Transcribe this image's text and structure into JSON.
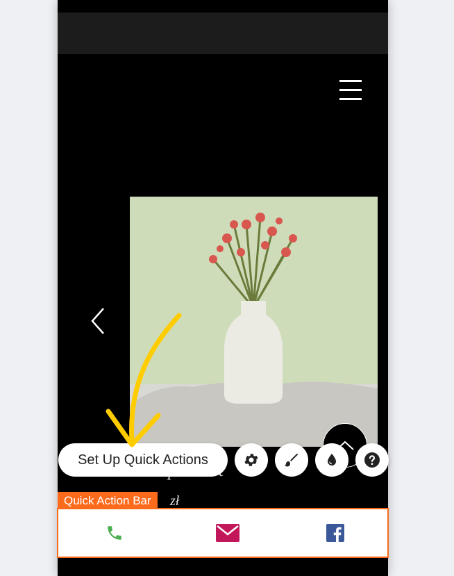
{
  "product": {
    "title": "I'm a product",
    "price": "zł"
  },
  "toolbar": {
    "setup_label": "Set Up Quick Actions",
    "settings_icon": "gear-icon",
    "design_icon": "paintbrush-icon",
    "color_icon": "drop-icon",
    "help_icon": "question-icon"
  },
  "quick_action_bar": {
    "label": "Quick Action Bar",
    "accent_color": "#fc6a1c",
    "items": [
      {
        "icon": "phone-icon",
        "color": "#4caf50"
      },
      {
        "icon": "mail-icon",
        "color": "#c2185b"
      },
      {
        "icon": "facebook-icon",
        "color": "#3b5998"
      }
    ]
  },
  "annotation_color": "#ffcc00"
}
